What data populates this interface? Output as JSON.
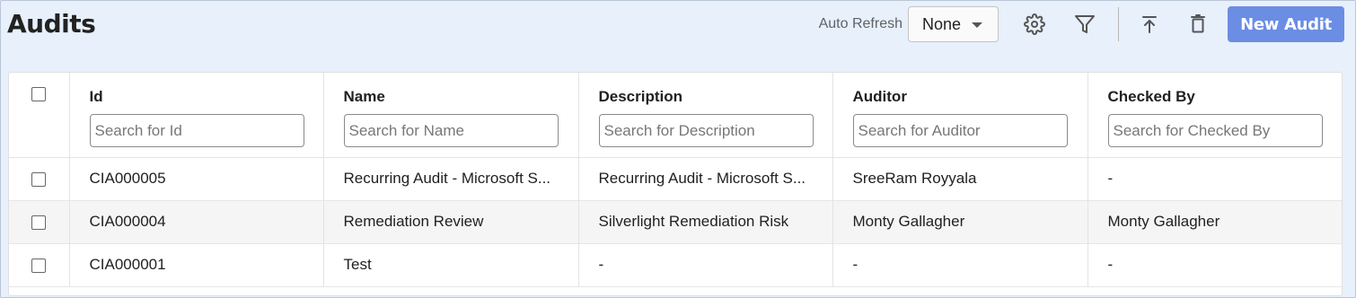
{
  "header": {
    "title": "Audits",
    "auto_refresh_label": "Auto Refresh",
    "auto_refresh_value": "None",
    "new_button_label": "New Audit",
    "accent_color": "#6b8de3"
  },
  "icons": [
    "gear-icon",
    "filter-icon",
    "export-icon",
    "trash-icon",
    "chevron-down-icon"
  ],
  "table": {
    "columns": [
      {
        "label": "Id",
        "placeholder": "Search for Id"
      },
      {
        "label": "Name",
        "placeholder": "Search for Name"
      },
      {
        "label": "Description",
        "placeholder": "Search for Description"
      },
      {
        "label": "Auditor",
        "placeholder": "Search for Auditor"
      },
      {
        "label": "Checked By",
        "placeholder": "Search for Checked By"
      }
    ],
    "rows": [
      [
        "CIA000005",
        "Recurring Audit - Microsoft S...",
        "Recurring Audit - Microsoft S...",
        "SreeRam Royyala",
        "-"
      ],
      [
        "CIA000004",
        "Remediation Review",
        "Silverlight Remediation Risk",
        "Monty Gallagher",
        "Monty Gallagher"
      ],
      [
        "CIA000001",
        "Test",
        "-",
        "-",
        "-"
      ]
    ]
  }
}
